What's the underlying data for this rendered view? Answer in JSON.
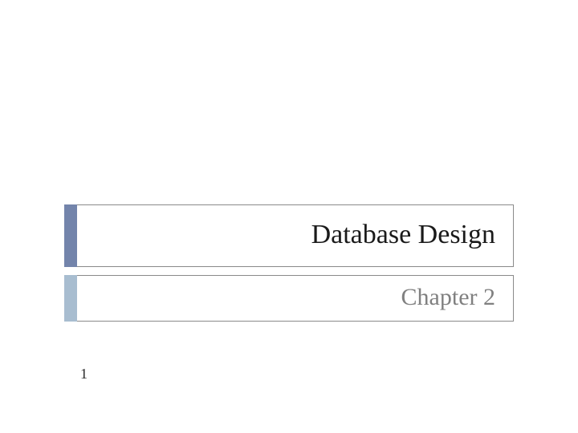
{
  "slide": {
    "title": "Database Design",
    "subtitle": "Chapter 2",
    "page_number": "1"
  },
  "colors": {
    "title_accent": "#7384ab",
    "subtitle_accent": "#a8bdd0",
    "border": "#8a8a8a",
    "subtitle_text": "#808080"
  }
}
